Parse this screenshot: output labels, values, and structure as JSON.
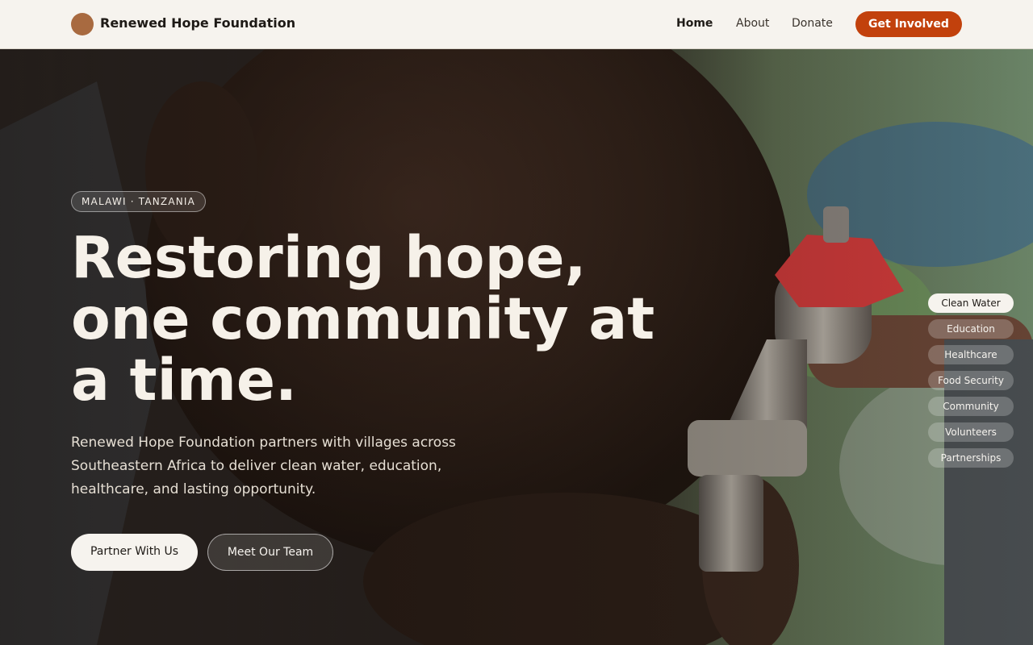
{
  "header": {
    "brand_name": "Renewed Hope Foundation",
    "nav": [
      {
        "label": "Home",
        "active": true
      },
      {
        "label": "About",
        "active": false
      },
      {
        "label": "Donate",
        "active": false
      }
    ],
    "cta_label": "Get Involved"
  },
  "hero": {
    "region_tag": "MALAWI · TANZANIA",
    "headline": "Restoring hope, one community at a time.",
    "subcopy": "Renewed Hope Foundation partners with villages across Southeastern Africa to deliver clean water, education, healthcare, and lasting opportunity.",
    "primary_button": "Partner With Us",
    "secondary_button": "Meet Our Team"
  },
  "topics": [
    {
      "label": "Clean Water",
      "active": true
    },
    {
      "label": "Education",
      "active": false
    },
    {
      "label": "Healthcare",
      "active": false
    },
    {
      "label": "Food Security",
      "active": false
    },
    {
      "label": "Community",
      "active": false
    },
    {
      "label": "Volunteers",
      "active": false
    },
    {
      "label": "Partnerships",
      "active": false
    }
  ],
  "colors": {
    "accent": "#c2410c",
    "brand_mark": "#a86a40",
    "header_bg": "#f6f3ee",
    "hero_text": "#f6f1e9"
  },
  "icons": {
    "brand_mark": "logo-circle-icon"
  }
}
